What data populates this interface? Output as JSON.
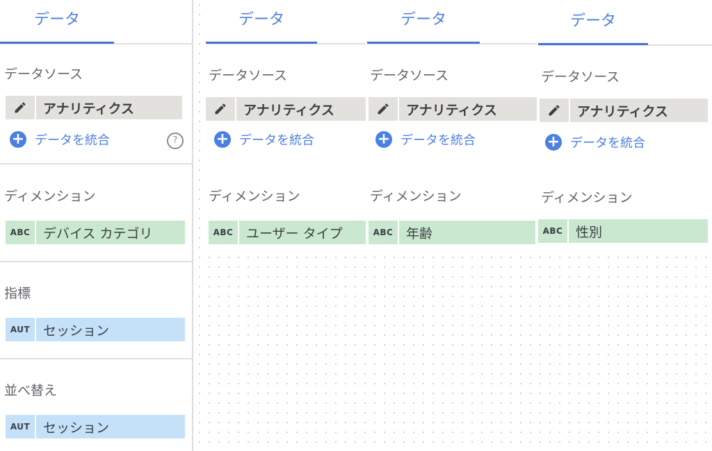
{
  "panels": [
    {
      "tab_label": "データ",
      "data_source_heading": "データソース",
      "data_source_name": "アナリティクス",
      "blend_label": "データを統合",
      "help_glyph": "?",
      "dimension_heading": "ディメンション",
      "dimension_type": "ABC",
      "dimension_value": "デバイス カテゴリ",
      "metric_heading": "指標",
      "metric_type": "AUT",
      "metric_value": "セッション",
      "sort_heading": "並べ替え",
      "sort_type": "AUT",
      "sort_value": "セッション"
    },
    {
      "tab_label": "データ",
      "data_source_heading": "データソース",
      "data_source_name": "アナリティクス",
      "blend_label": "データを統合",
      "dimension_heading": "ディメンション",
      "dimension_type": "ABC",
      "dimension_value": "ユーザー タイプ"
    },
    {
      "tab_label": "データ",
      "data_source_heading": "データソース",
      "data_source_name": "アナリティクス",
      "blend_label": "データを統合",
      "dimension_heading": "ディメンション",
      "dimension_type": "ABC",
      "dimension_value": "年齢"
    },
    {
      "tab_label": "データ",
      "data_source_heading": "データソース",
      "data_source_name": "アナリティクス",
      "blend_label": "データを統合",
      "dimension_heading": "ディメンション",
      "dimension_type": "ABC",
      "dimension_value": "性別"
    }
  ],
  "colors": {
    "accent": "#4f7fe0",
    "dimension_chip": "#cae7cf",
    "metric_chip": "#c5e1fa",
    "source_chip": "#e3e1de"
  },
  "icons": {
    "edit": "pencil-icon",
    "blend": "plus-circle-icon",
    "help": "help-icon"
  }
}
